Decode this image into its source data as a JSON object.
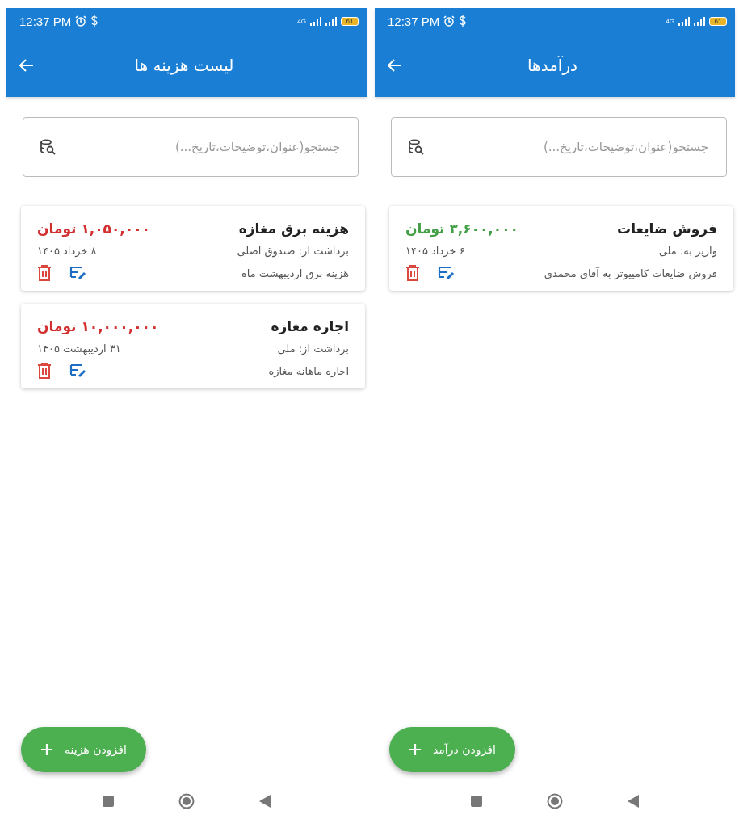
{
  "screens": [
    {
      "status_bar": {
        "time": "12:37 PM",
        "network": "4G",
        "battery": "61"
      },
      "title": "درآمدها",
      "search": {
        "placeholder": "جستجو(عنوان،توضیحات،تاریخ...)"
      },
      "entries": [
        {
          "color": "#43a047",
          "title": "فروش ضایعات",
          "amount": "۳,۶۰۰,۰۰۰ تومان",
          "account": "واریز به: ملی",
          "date": "۶ خرداد ۱۴۰۵",
          "description": "فروش ضایعات کامپیوتر به آقای محمدی"
        }
      ],
      "fab": "افزودن درآمد"
    },
    {
      "status_bar": {
        "time": "12:37 PM",
        "network": "4G",
        "battery": "61"
      },
      "title": "لیست هزینه ها",
      "search": {
        "placeholder": "جستجو(عنوان،توضیحات،تاریخ...)"
      },
      "entries": [
        {
          "color": "#d32f2f",
          "title": "هزینه برق مغازه",
          "amount": "۱,۰۵۰,۰۰۰ تومان",
          "account": "برداشت از: صندوق اصلی",
          "date": "۸ خرداد ۱۴۰۵",
          "description": "هزینه برق اردیبهشت ماه"
        },
        {
          "color": "#d32f2f",
          "title": "اجاره مغازه",
          "amount": "۱۰,۰۰۰,۰۰۰ تومان",
          "account": "برداشت از: ملی",
          "date": "۳۱ اردیبهشت ۱۴۰۵",
          "description": "اجاره ماهانه مغازه"
        }
      ],
      "fab": "افزودن هزینه"
    }
  ]
}
